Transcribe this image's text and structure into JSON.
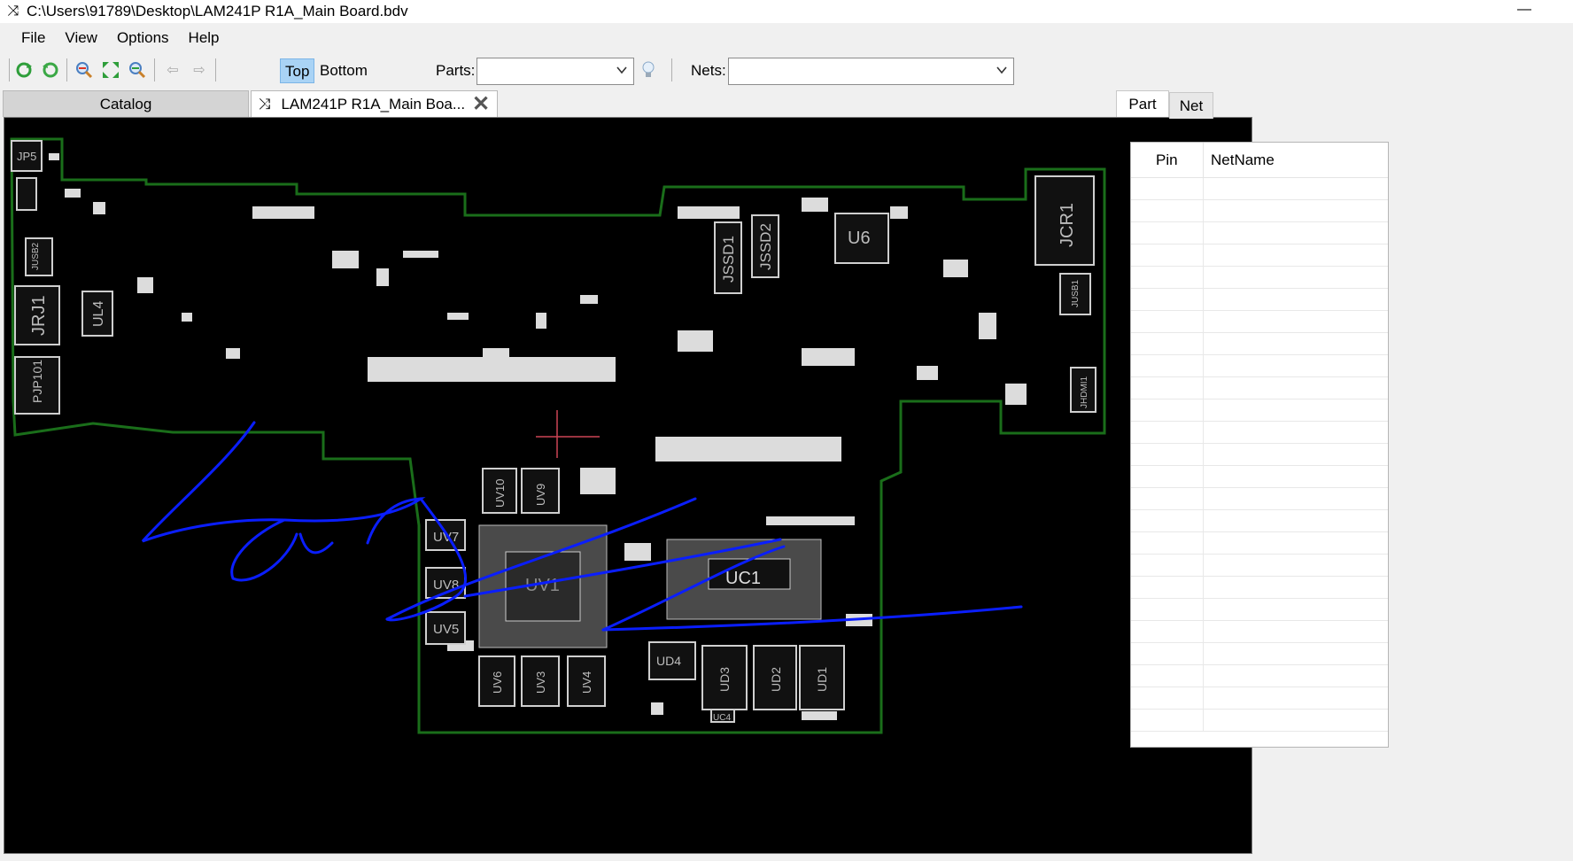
{
  "window": {
    "title": "C:\\Users\\91789\\Desktop\\LAM241P R1A_Main Board.bdv",
    "app_icon": "shuffle-icon",
    "minimize_glyph": "—"
  },
  "menu": [
    "File",
    "View",
    "Options",
    "Help"
  ],
  "toolbar": {
    "icons": [
      "refresh-icon",
      "reload-icon",
      "zoom-in-icon",
      "fit-icon",
      "zoom-out-icon",
      "back-arrow-icon",
      "forward-arrow-icon"
    ],
    "top_label": "Top",
    "bottom_label": "Bottom",
    "parts_label": "Parts:",
    "parts_value": "",
    "nets_label": "Nets:",
    "nets_value": "",
    "highlight_icon": "bulb-icon"
  },
  "doc_tabs": {
    "catalog": "Catalog",
    "board": "LAM241P R1A_Main Boa..."
  },
  "board": {
    "outline_color": "#1a6e1a",
    "annotation_color": "#0a1eff",
    "labels": {
      "jp5": "JP5",
      "jusb2": "JUSB2",
      "jrj1": "JRJ1",
      "pjp101": "PJP101",
      "ul4": "UL4",
      "jssd1": "JSSD1",
      "jssd2": "JSSD2",
      "u6": "U6",
      "jcr1": "JCR1",
      "jusb1": "JUSB1",
      "jhdmi1": "JHDMI1",
      "uv10": "UV10",
      "uv9": "UV9",
      "uv7": "UV7",
      "uv8": "UV8",
      "uv5": "UV5",
      "uv1": "UV1",
      "uv6": "UV6",
      "uv3": "UV3",
      "uv4": "UV4",
      "uc1": "UC1",
      "ud4": "UD4",
      "ud3": "UD3",
      "ud2": "UD2",
      "ud1": "UD1",
      "uc4": "UC4"
    }
  },
  "side_panel": {
    "tab_part": "Part",
    "tab_net": "Net",
    "col_pin": "Pin",
    "col_netname": "NetName"
  }
}
